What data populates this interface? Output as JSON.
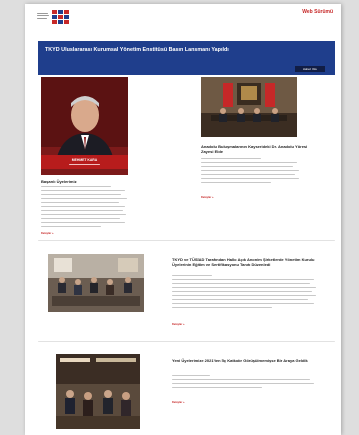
{
  "header": {
    "logo_alt": "TKYD logo",
    "link_label": "Web Sürümü"
  },
  "banner": {
    "title": "TKYD Uluslararası Kurumsal Yönetim Enstitüsü Basın Lansmanı Yapıldı",
    "button_label": "Haberi Oku"
  },
  "articles": [
    {
      "title": "Başarılı Üyelerimiz",
      "photo_caption": "MEHMET KARA",
      "more_label": "Detaylar »"
    },
    {
      "title": "Anadolu Buluşmalarının Kayserideki Dr. Anadolu Yöresi Zayesi Elde",
      "more_label": "Detaylar »"
    },
    {
      "title": "TKYD ve TÜSİAD Tarafından Hallo Açık Anonim Şirketlerde Yönetim Kurulu Üyelerinin Eğitim ve Sertifikasyonu Tanıtı Düzenledi",
      "more_label": "Detaylar »"
    },
    {
      "title": "Yeni Üyelerimize 2021'ten İlç Katkıdır Görüşülmemişse Bir Araya Geldik",
      "more_label": "Detaylar »"
    }
  ],
  "colors": {
    "banner": "#1f3e8c",
    "accent": "#c62828"
  }
}
